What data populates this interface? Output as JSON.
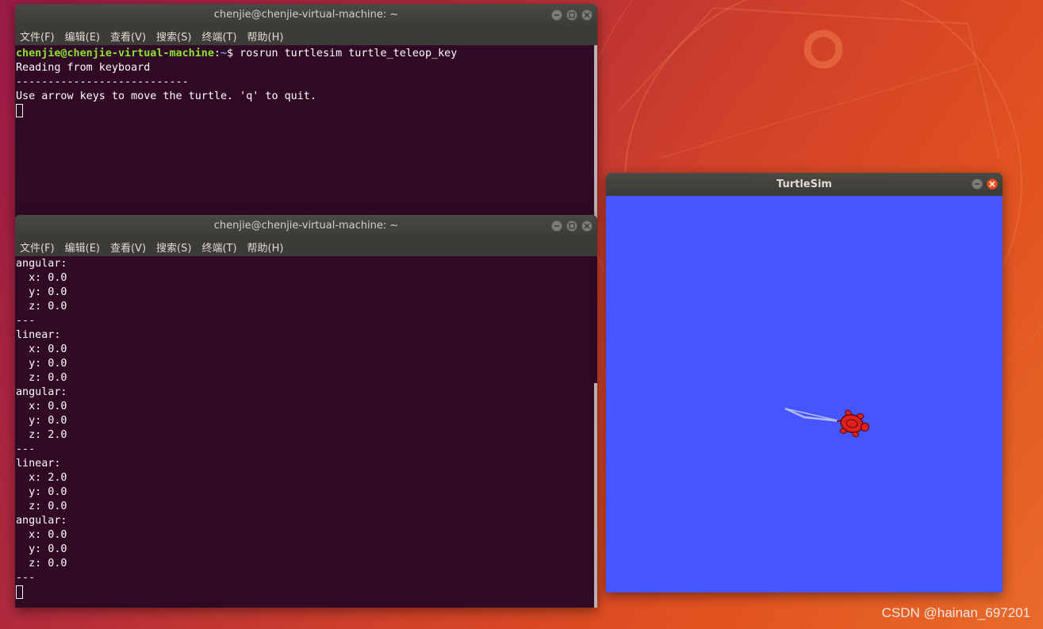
{
  "terminal_top": {
    "title": "chenjie@chenjie-virtual-machine: ~",
    "menu": [
      "文件(F)",
      "编辑(E)",
      "查看(V)",
      "搜索(S)",
      "终端(T)",
      "帮助(H)"
    ],
    "prompt_user": "chenjie@chenjie-virtual-machine",
    "prompt_sep": ":",
    "prompt_path": "~",
    "prompt_end": "$ rosrun turtlesim turtle_teleop_key",
    "lines": [
      "Reading from keyboard",
      "---------------------------",
      "Use arrow keys to move the turtle. 'q' to quit."
    ]
  },
  "terminal_bottom": {
    "title": "chenjie@chenjie-virtual-machine: ~",
    "menu": [
      "文件(F)",
      "编辑(E)",
      "查看(V)",
      "搜索(S)",
      "终端(T)",
      "帮助(H)"
    ],
    "lines": [
      "angular:",
      "  x: 0.0",
      "  y: 0.0",
      "  z: 0.0",
      "---",
      "linear:",
      "  x: 0.0",
      "  y: 0.0",
      "  z: 0.0",
      "angular:",
      "  x: 0.0",
      "  y: 0.0",
      "  z: 2.0",
      "---",
      "linear:",
      "  x: 2.0",
      "  y: 0.0",
      "  z: 0.0",
      "angular:",
      "  x: 0.0",
      "  y: 0.0",
      "  z: 0.0",
      "---"
    ]
  },
  "turtlesim": {
    "title": "TurtleSim",
    "background_color": "#4556ff",
    "pen_color": "#b3b8ff",
    "turtle_color": "#e0201c"
  },
  "watermark": "CSDN @hainan_697201",
  "colors": {
    "terminal_bg": "#300a24",
    "accent_orange": "#e95420"
  }
}
